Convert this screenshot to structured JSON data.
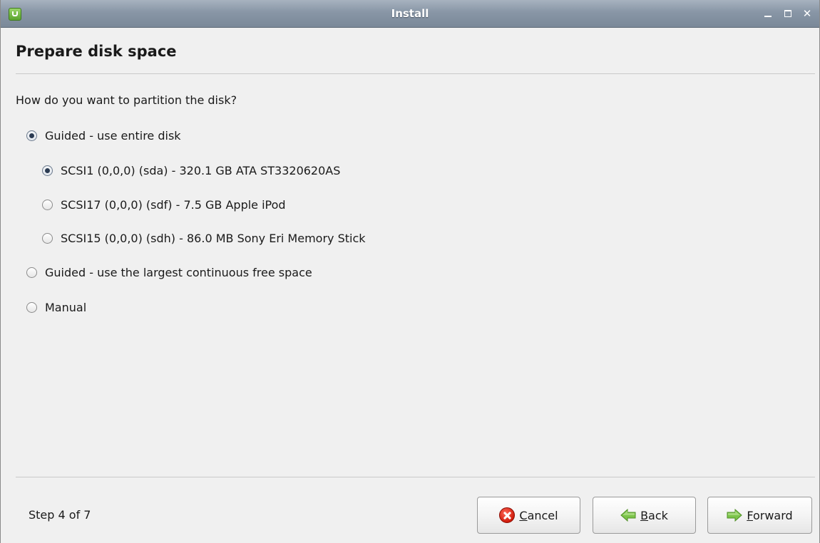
{
  "window": {
    "title": "Install"
  },
  "header": {
    "title": "Prepare disk space"
  },
  "question": "How do you want to partition the disk?",
  "options": [
    {
      "label": "Guided - use entire disk",
      "checked": true
    },
    {
      "label": "SCSI1 (0,0,0) (sda) - 320.1 GB ATA ST3320620AS",
      "checked": true
    },
    {
      "label": "SCSI17 (0,0,0) (sdf) - 7.5 GB Apple iPod",
      "checked": false
    },
    {
      "label": "SCSI15 (0,0,0) (sdh) - 86.0 MB Sony Eri Memory Stick",
      "checked": false
    },
    {
      "label": "Guided - use the largest continuous free space",
      "checked": false
    },
    {
      "label": "Manual",
      "checked": false
    }
  ],
  "footer": {
    "step": "Step 4 of 7",
    "cancel_mnemonic": "C",
    "cancel_rest": "ancel",
    "back_mnemonic": "B",
    "back_rest": "ack",
    "forward_mnemonic": "F",
    "forward_rest": "orward"
  },
  "icons": {
    "app": "linux-mint-icon",
    "cancel": "cancel-x-icon",
    "back": "green-left-arrow-icon",
    "forward": "green-right-arrow-icon"
  },
  "colors": {
    "titlebar": "#8896a6",
    "cancel_icon": "#d01c0c",
    "arrow_icon": "#6cbf3a"
  }
}
